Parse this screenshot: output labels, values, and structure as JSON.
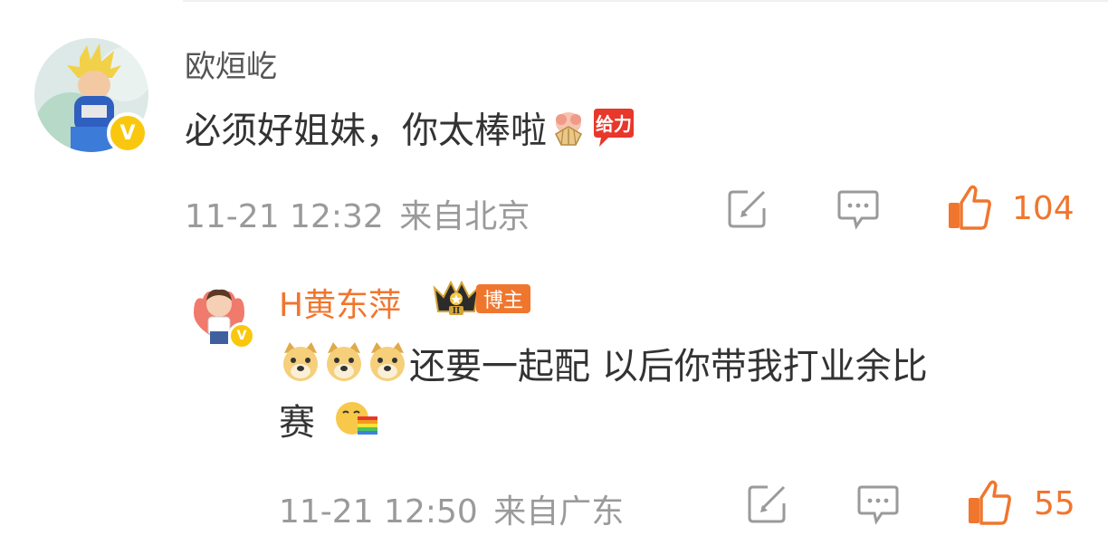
{
  "colors": {
    "accent": "#f0762e",
    "meta": "#9a9a9a",
    "text": "#333333",
    "verified": "#f9c80e"
  },
  "comment": {
    "username": "欧烜屹",
    "text": "必须好姐妹，你太棒啦",
    "emojis": [
      "fan-emoji",
      "refuel-emoji"
    ],
    "emoji_sticker_label": "给力",
    "timestamp": "11-21 12:32",
    "location": "来自北京",
    "like_count": "104",
    "verified_badge": "V",
    "icons": [
      "share-icon",
      "comment-icon",
      "like-icon"
    ]
  },
  "reply": {
    "username": "H黄东萍",
    "badge_label": "博主",
    "crown_level": "II",
    "text_line1": "还要一起配 以后你带我打业余比",
    "text_line2": "赛",
    "emojis_prefix": [
      "doge-emoji",
      "doge-emoji",
      "doge-emoji"
    ],
    "emoji_suffix": "rainbow-vomit-emoji",
    "timestamp": "11-21 12:50",
    "location": "来自广东",
    "like_count": "55",
    "verified_badge": "V",
    "icons": [
      "share-icon",
      "comment-icon",
      "like-icon"
    ]
  }
}
